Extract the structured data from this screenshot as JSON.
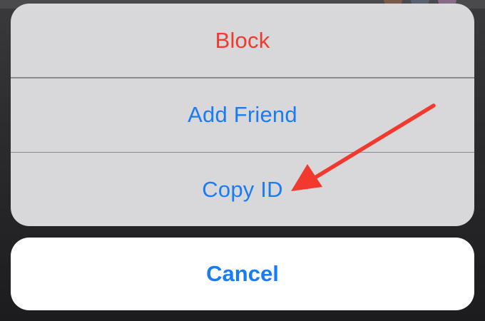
{
  "action_sheet": {
    "items": [
      {
        "label": "Block",
        "style": "destructive",
        "color": "#f2392f"
      },
      {
        "label": "Add Friend",
        "style": "default",
        "color": "#1a7cf5"
      },
      {
        "label": "Copy ID",
        "style": "default",
        "color": "#1a7cf5"
      }
    ]
  },
  "cancel": {
    "label": "Cancel",
    "color": "#1a7cf5"
  },
  "annotation": {
    "icon": "red-arrow-icon",
    "color": "#f2392f",
    "target": "Copy ID"
  }
}
